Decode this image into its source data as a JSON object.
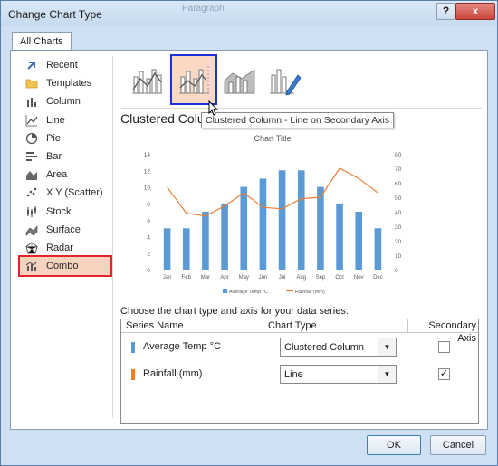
{
  "window": {
    "title": "Change Chart Type",
    "ghost_title": "Paragraph",
    "help_label": "?",
    "close_label": "x"
  },
  "tabs": [
    {
      "label": "All Charts"
    }
  ],
  "sidebar": {
    "items": [
      {
        "label": "Recent",
        "icon": "recent-icon"
      },
      {
        "label": "Templates",
        "icon": "folder-icon"
      },
      {
        "label": "Column",
        "icon": "column-chart-icon"
      },
      {
        "label": "Line",
        "icon": "line-chart-icon"
      },
      {
        "label": "Pie",
        "icon": "pie-chart-icon"
      },
      {
        "label": "Bar",
        "icon": "bar-chart-icon"
      },
      {
        "label": "Area",
        "icon": "area-chart-icon"
      },
      {
        "label": "X Y (Scatter)",
        "icon": "scatter-chart-icon"
      },
      {
        "label": "Stock",
        "icon": "stock-chart-icon"
      },
      {
        "label": "Surface",
        "icon": "surface-chart-icon"
      },
      {
        "label": "Radar",
        "icon": "radar-chart-icon"
      },
      {
        "label": "Combo",
        "icon": "combo-chart-icon",
        "selected": true
      }
    ]
  },
  "subtypes": [
    {
      "icon": "clustered-column-line-icon"
    },
    {
      "icon": "clustered-column-line-secondary-icon",
      "selected": true
    },
    {
      "icon": "stacked-area-column-icon"
    },
    {
      "icon": "custom-combo-icon"
    }
  ],
  "heading": "Clustered Column",
  "tooltip": "Clustered Column - Line on Secondary Axis",
  "section_label": "Choose the chart type and axis for your data series:",
  "series_table": {
    "headers": [
      "Series Name",
      "Chart Type",
      "Secondary Axis"
    ],
    "rows": [
      {
        "name": "Average Temp °C",
        "color": "#5b9bd5",
        "chart_type": "Clustered Column",
        "secondary": false
      },
      {
        "name": "Rainfall (mm)",
        "color": "#ed7d31",
        "chart_type": "Line",
        "secondary": true
      }
    ]
  },
  "buttons": {
    "ok": "OK",
    "cancel": "Cancel"
  },
  "chart_data": {
    "type": "bar",
    "title": "Chart Title",
    "categories": [
      "Jan",
      "Feb",
      "Mar",
      "Apr",
      "May",
      "Jun",
      "Jul",
      "Aug",
      "Sep",
      "Oct",
      "Nov",
      "Dec"
    ],
    "series": [
      {
        "name": "Average Temp °C",
        "kind": "column",
        "axis": "primary",
        "color": "#5b9bd5",
        "values": [
          5,
          5,
          7,
          8,
          10,
          11,
          12,
          12,
          10,
          8,
          7,
          5
        ]
      },
      {
        "name": "Rainfall (mm)",
        "kind": "line",
        "axis": "secondary",
        "color": "#ed7d31",
        "values": [
          57,
          39,
          37,
          44,
          53,
          43,
          42,
          49,
          50,
          70,
          63,
          53
        ]
      }
    ],
    "ylim": [
      0,
      14
    ],
    "yticks": [
      0,
      2,
      4,
      6,
      8,
      10,
      12,
      14
    ],
    "y2lim": [
      0,
      80
    ],
    "y2ticks": [
      0,
      10,
      20,
      30,
      40,
      50,
      60,
      70,
      80
    ],
    "legend_position": "bottom"
  }
}
